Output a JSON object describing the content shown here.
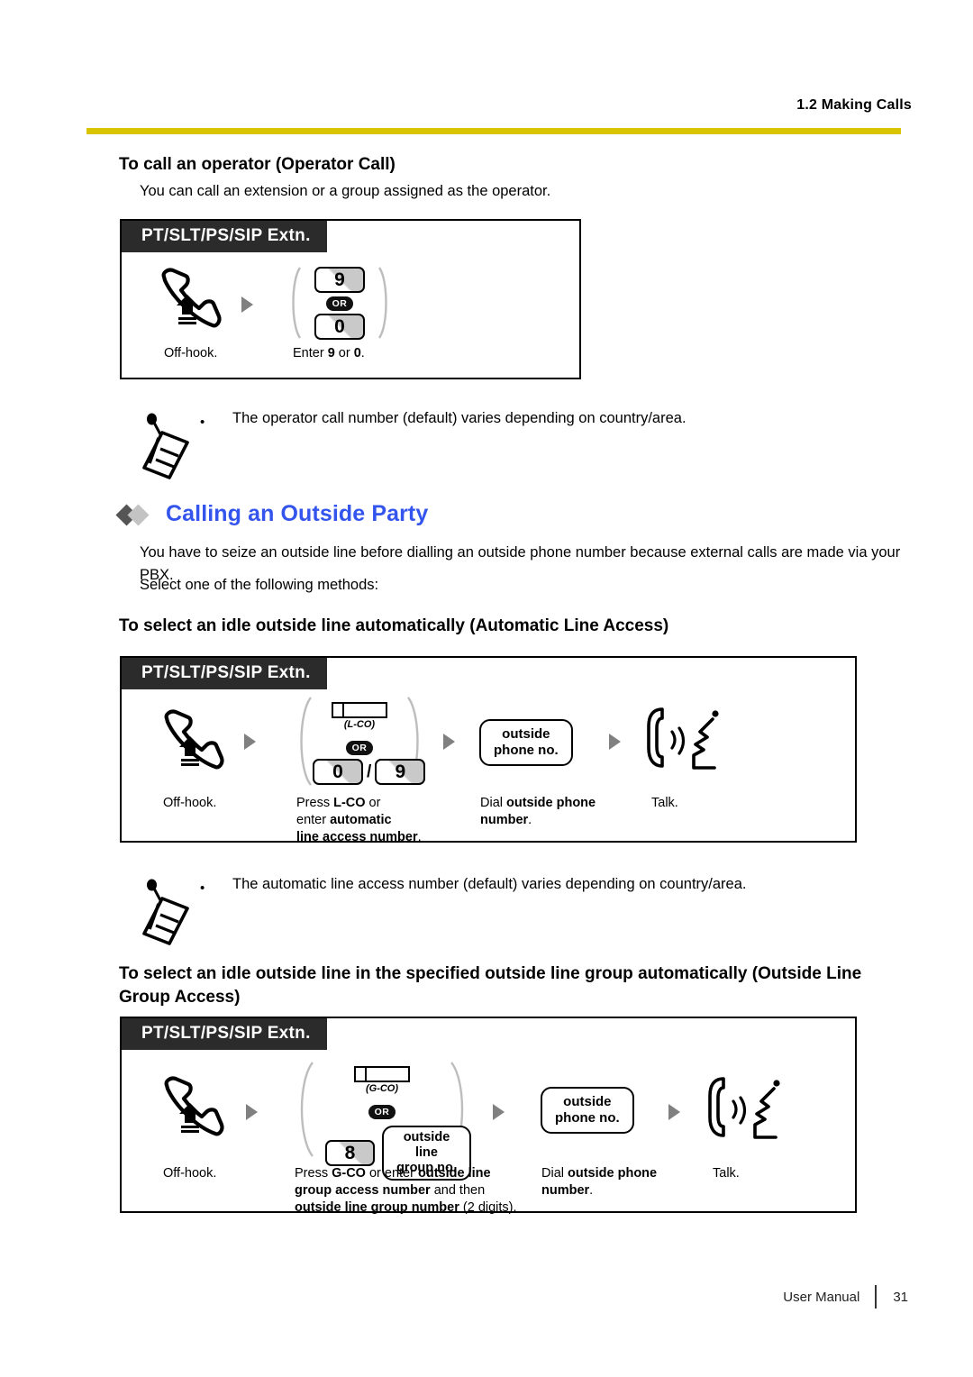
{
  "header": {
    "section_label": "1.2 Making Calls"
  },
  "operator": {
    "heading": "To call an operator (Operator Call)",
    "intro": "You can call an extension or a group assigned as the operator.",
    "box": {
      "tab_label": "PT/SLT/PS/SIP Extn.",
      "steps": [
        {
          "caption": "Off-hook.",
          "icon": "offhook-handset-icon"
        },
        {
          "caption_pre": "Enter ",
          "key_a": "9",
          "caption_mid": " or ",
          "key_b": "0",
          "caption_post": ".",
          "or_label": "OR"
        }
      ]
    },
    "note": {
      "bullet": "•",
      "text": "The operator call number (default) varies depending on country/area."
    }
  },
  "outside_party": {
    "heading": "Calling an Outside Party",
    "para1": "You have to seize an outside line before dialling an outside phone number because external calls are made via your PBX.",
    "para2": "Select one of the following methods:"
  },
  "automatic_line_access": {
    "heading": "To select an idle outside line automatically (Automatic Line Access)",
    "box": {
      "tab_label": "PT/SLT/PS/SIP Extn.",
      "co_key_label": "(L-CO)",
      "or_label": "OR",
      "key_a": "0",
      "key_sep": "/",
      "key_b": "9",
      "phone_box_line1": "outside",
      "phone_box_line2": "phone no.",
      "captions": {
        "offhook": "Off-hook.",
        "press_line1_pre": "Press ",
        "press_line1_bold": "L-CO",
        "press_line1_post": " or",
        "press_line2_pre": "enter ",
        "press_line2_bold": "automatic",
        "press_line3_bold": "line access number",
        "press_line3_post": ".",
        "dial_pre": "Dial ",
        "dial_bold1": "outside phone",
        "dial_bold2": "number",
        "dial_post": ".",
        "talk": "Talk."
      }
    },
    "note": {
      "bullet": "•",
      "text": "The automatic line access number (default) varies depending on country/area."
    }
  },
  "group_access": {
    "heading": "To select an idle outside line in the specified outside line group automatically (Outside Line Group Access)",
    "box": {
      "tab_label": "PT/SLT/PS/SIP Extn.",
      "co_key_label": "(G-CO)",
      "or_label": "OR",
      "key_a": "8",
      "group_box_line1": "outside line",
      "group_box_line2": "group no.",
      "phone_box_line1": "outside",
      "phone_box_line2": "phone no.",
      "captions": {
        "offhook": "Off-hook.",
        "press_line1_pre": "Press ",
        "press_line1_bold1": "G-CO",
        "press_line1_mid": " or enter ",
        "press_line1_bold2": "outside line",
        "press_line2_bold": "group access number",
        "press_line2_post": " and then",
        "press_line3_bold": "outside line group number",
        "press_line3_post": " (2 digits).",
        "dial_pre": "Dial ",
        "dial_bold1": "outside phone",
        "dial_bold2": "number",
        "dial_post": ".",
        "talk": "Talk."
      }
    }
  },
  "footer": {
    "manual": "User Manual",
    "page": "31"
  },
  "colors": {
    "rule": "#d8c400",
    "heading_blue": "#3355ee",
    "tab_bg": "#2b2b2b",
    "arrow_gray": "#808080",
    "diamond_dark": "#555555",
    "diamond_light": "#c3c3c3"
  }
}
